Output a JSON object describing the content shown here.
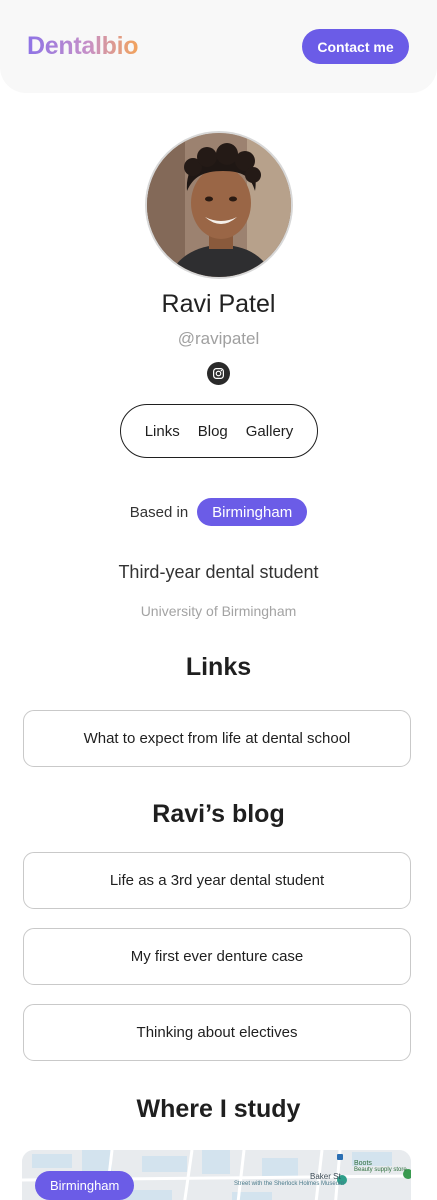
{
  "header": {
    "logo": "Dentalbio",
    "contact_label": "Contact me"
  },
  "profile": {
    "name": "Ravi Patel",
    "handle": "@ravipatel",
    "social_icon": "instagram-icon"
  },
  "tabs": [
    {
      "label": "Links"
    },
    {
      "label": "Blog"
    },
    {
      "label": "Gallery"
    }
  ],
  "location": {
    "label": "Based in",
    "city": "Birmingham"
  },
  "bio": {
    "title": "Third-year dental student",
    "university": "University of Birmingham"
  },
  "links_section": {
    "title": "Links",
    "items": [
      "What to expect from life at dental school"
    ]
  },
  "blog_section": {
    "title": "Ravi’s blog",
    "items": [
      "Life as a 3rd year dental student",
      "My first ever denture case",
      "Thinking about electives"
    ]
  },
  "study_section": {
    "title": "Where I study",
    "map_pill": "Birmingham",
    "map_labels": {
      "baker_st": "Baker St",
      "boots": "Boots",
      "boots_sub": "Beauty supply store",
      "museum": "Street with the Sherlock Holmes Museum"
    }
  },
  "colors": {
    "accent": "#6b5ce7",
    "logo_gradient": [
      "#8e73e6",
      "#f2a35c"
    ]
  }
}
